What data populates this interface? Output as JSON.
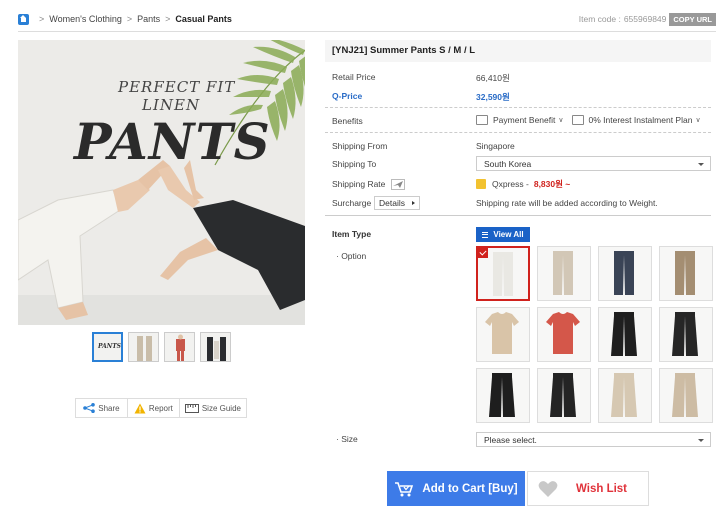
{
  "breadcrumb": {
    "items": [
      "Women's Clothing",
      "Pants",
      "Casual Pants"
    ],
    "separator": ">"
  },
  "item_code": {
    "label": "Item code :",
    "value": "655969849",
    "copy_label": "COPY URL"
  },
  "main_image": {
    "line1": "PERFECT FIT",
    "line2": "LINEN",
    "line3": "PANTS"
  },
  "thumbnails": {
    "count": 4,
    "selected_index": 0,
    "first_label": "PANTS"
  },
  "share_bar": {
    "share": "Share",
    "report": "Report",
    "size_guide": "Size Guide"
  },
  "product": {
    "title": "[YNJ21] Summer Pants S / M / L",
    "retail_price_label": "Retail Price",
    "retail_price": "66,410원",
    "q_price_label": "Q-Price",
    "q_price": "32,590원",
    "benefits_label": "Benefits",
    "payment_benefit": "Payment Benefit",
    "installment": "0% Interest Instalment Plan",
    "shipping_from_label": "Shipping From",
    "shipping_from": "Singapore",
    "shipping_to_label": "Shipping To",
    "shipping_to": "South Korea",
    "shipping_rate_label": "Shipping Rate",
    "shipping_carrier": "Qxpress -",
    "shipping_price": "8,830원 ~",
    "surcharge_label": "Surcharge",
    "details_label": "Details",
    "surcharge_note": "Shipping rate will be added according to Weight.",
    "item_type_label": "Item Type",
    "view_all_label": "View All",
    "option_label": "· Option",
    "size_label": "· Size",
    "size_placeholder": "Please select."
  },
  "options": [
    {
      "color": "#e9e8e3",
      "selected": true
    },
    {
      "color": "#d2c7b6",
      "selected": false
    },
    {
      "color": "#3a4456",
      "selected": false
    },
    {
      "color": "#a48e72",
      "selected": false
    },
    {
      "color": "#d9c4a8",
      "selected": false
    },
    {
      "color": "#d4574a",
      "selected": false
    },
    {
      "color": "#1f1f1f",
      "selected": false
    },
    {
      "color": "#262626",
      "selected": false
    },
    {
      "color": "#1e1e1e",
      "selected": false
    },
    {
      "color": "#242424",
      "selected": false
    },
    {
      "color": "#d6c8b2",
      "selected": false
    },
    {
      "color": "#cdbca4",
      "selected": false
    }
  ],
  "actions": {
    "add_to_cart": "Add to Cart [Buy]",
    "wish_list": "Wish List"
  },
  "colors": {
    "accent_blue": "#2a80d6",
    "qprice_blue": "#2a6cc7",
    "red": "#d0221d",
    "cart_blue": "#3d7be8"
  }
}
